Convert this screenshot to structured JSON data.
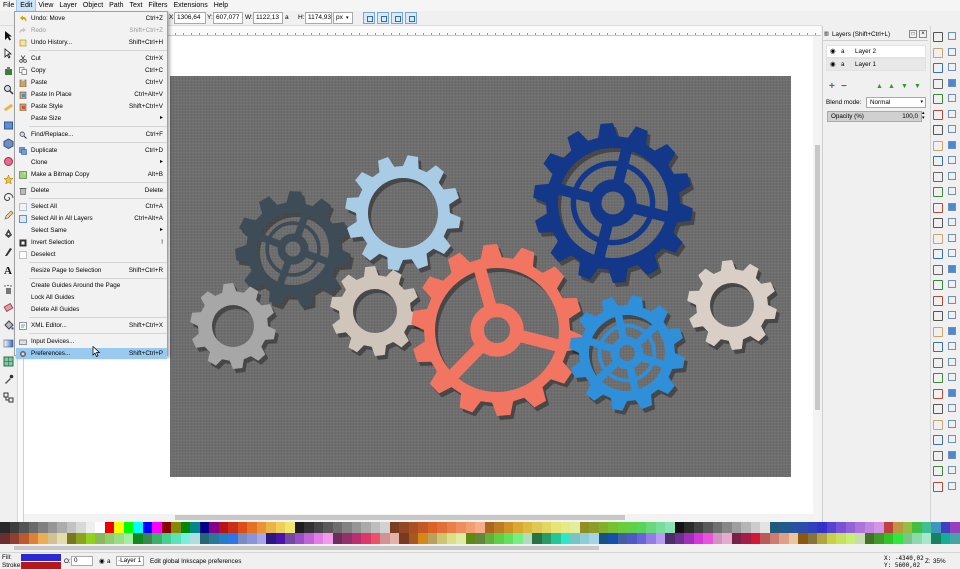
{
  "menubar": {
    "items": [
      "File",
      "Edit",
      "View",
      "Layer",
      "Object",
      "Path",
      "Text",
      "Filters",
      "Extensions",
      "Help"
    ]
  },
  "toolbar": {
    "x_label": "X:",
    "x_value": "1306,64",
    "y_label": "Y:",
    "y_value": "607,077",
    "w_label": "W:",
    "w_value": "1122,13",
    "lock_glyph": "a",
    "h_label": "H:",
    "h_value": "1174,93",
    "unit": "px"
  },
  "edit_menu": {
    "items": [
      {
        "label": "Undo: Move",
        "shortcut": "Ctrl+Z"
      },
      {
        "label": "Redo",
        "shortcut": "Shift+Ctrl+Z"
      },
      {
        "label": "Undo History...",
        "shortcut": "Shift+Ctrl+H"
      },
      {
        "label": "Cut",
        "shortcut": "Ctrl+X"
      },
      {
        "label": "Copy",
        "shortcut": "Ctrl+C"
      },
      {
        "label": "Paste",
        "shortcut": "Ctrl+V"
      },
      {
        "label": "Paste In Place",
        "shortcut": "Ctrl+Alt+V"
      },
      {
        "label": "Paste Style",
        "shortcut": "Shift+Ctrl+V"
      },
      {
        "label": "Paste Size",
        "shortcut": ""
      },
      {
        "label": "Find/Replace...",
        "shortcut": "Ctrl+F"
      },
      {
        "label": "Duplicate",
        "shortcut": "Ctrl+D"
      },
      {
        "label": "Clone",
        "shortcut": ""
      },
      {
        "label": "Make a Bitmap Copy",
        "shortcut": "Alt+B"
      },
      {
        "label": "Delete",
        "shortcut": "Delete"
      },
      {
        "label": "Select All",
        "shortcut": "Ctrl+A"
      },
      {
        "label": "Select All in All Layers",
        "shortcut": "Ctrl+Alt+A"
      },
      {
        "label": "Select Same",
        "shortcut": ""
      },
      {
        "label": "Invert Selection",
        "shortcut": "!"
      },
      {
        "label": "Deselect",
        "shortcut": ""
      },
      {
        "label": "Resize Page to Selection",
        "shortcut": "Shift+Ctrl+R"
      },
      {
        "label": "Create Guides Around the Page",
        "shortcut": ""
      },
      {
        "label": "Lock All Guides",
        "shortcut": ""
      },
      {
        "label": "Delete All Guides",
        "shortcut": ""
      },
      {
        "label": "XML Editor...",
        "shortcut": "Shift+Ctrl+X"
      },
      {
        "label": "Input Devices...",
        "shortcut": ""
      },
      {
        "label": "Preferences...",
        "shortcut": "Shift+Ctrl+P"
      }
    ]
  },
  "layers_panel": {
    "title": "Layers (Shift+Ctrl+L)",
    "layers": [
      "Layer 2",
      "Layer 1"
    ],
    "blend_label": "Blend mode:",
    "blend_value": "Normal",
    "opacity_label": "Opacity (%)",
    "opacity_value": "100,0"
  },
  "statusbar": {
    "fill_label": "Fill:",
    "stroke_label": "Stroke:",
    "opacity_prefix": "O:",
    "opacity_value": "0",
    "layer_value": "·Layer 1",
    "message": "Edit global Inkscape preferences",
    "coords": "X: -4340,02\nY: 5600,02",
    "zoom_label": "Z:",
    "zoom_value": "35%"
  },
  "colors": {
    "page_bg": "#6e6e6e",
    "menu_highlight": "#99c9ef",
    "fill_swatch": "#2a2ad4",
    "stroke_swatch": "#b01a1a"
  },
  "icons": {
    "tool_icons": [
      "selector-icon",
      "node-icon",
      "tweak-icon",
      "zoom-icon",
      "measure-icon",
      "rect-icon",
      "3dbox-icon",
      "ellipse-icon",
      "star-icon",
      "spiral-icon",
      "pencil-icon",
      "pen-icon",
      "calligraphy-icon",
      "text-icon",
      "spray-icon",
      "eraser-icon",
      "bucket-icon",
      "gradient-icon",
      "mesh-icon",
      "dropper-icon",
      "connector-icon"
    ]
  }
}
